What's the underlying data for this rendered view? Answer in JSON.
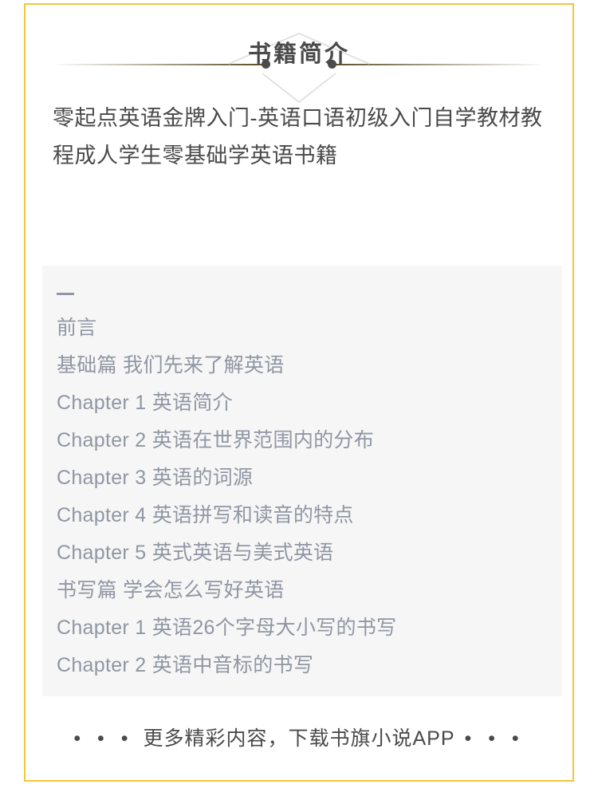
{
  "frame": {
    "border_color": "#f5c638"
  },
  "header": {
    "title": "书籍简介",
    "rule_color": "#5a4e28",
    "dot_color": "#4c4c4c",
    "triangle_color": "#e0e0e0",
    "left_dot_icon": "bullet-dot-icon",
    "right_dot_icon": "bullet-dot-icon",
    "top_triangle_icon": "triangle-up-outline-icon",
    "bottom_triangle_icon": "chevron-down-outline-icon"
  },
  "book": {
    "title": "零起点英语金牌入门-英语口语初级入门自学教材教程成人学生零基础学英语书籍",
    "title_color": "#4a4a4a"
  },
  "catalog": {
    "background_color": "#f6f6f6",
    "text_color": "#9096a3",
    "dash_marker": "—",
    "entries": [
      "前言",
      "基础篇 我们先来了解英语",
      "Chapter 1 英语简介",
      "Chapter 2 英语在世界范围内的分布",
      "Chapter 3 英语的词源",
      "Chapter 4 英语拼写和读音的特点",
      "Chapter 5 英式英语与美式英语",
      "书写篇 学会怎么写好英语",
      "Chapter 1 英语26个字母大小写的书写",
      "Chapter 2 英语中音标的书写"
    ]
  },
  "footer": {
    "dots_left": "• • •",
    "text": "更多精彩内容，下载书旗小说APP",
    "dots_right": "• • •",
    "text_color": "#4a4a4a"
  }
}
